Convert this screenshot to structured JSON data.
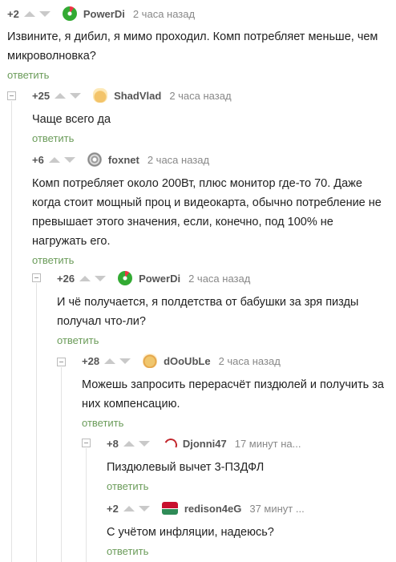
{
  "comments": [
    {
      "rating": "+2",
      "nick": "PowerDi",
      "time": "2 часа назад",
      "text": "Извините, я дибил, я мимо проходил. Комп потребляет меньше, чем микроволновка?",
      "reply": "ответить",
      "avatar": "clover-icon"
    },
    {
      "rating": "+25",
      "nick": "ShadVlad",
      "time": "2 часа назад",
      "text": "Чаще всего да",
      "reply": "ответить",
      "avatar": "face-icon"
    },
    {
      "rating": "+6",
      "nick": "foxnet",
      "time": "2 часа назад",
      "text": "Комп потребляет около 200Вт, плюс монитор где-то 70. Даже когда стоит мощный проц и видеокарта, обычно потребление не превышает этого значения, если, конечно, под 100% не нагружать его.",
      "reply": "ответить",
      "avatar": "disc-icon"
    },
    {
      "rating": "+26",
      "nick": "PowerDi",
      "time": "2 часа назад",
      "text": "И чё получается, я полдетства от бабушки за зря пизды получал что-ли?",
      "reply": "ответить",
      "avatar": "clover-icon"
    },
    {
      "rating": "+28",
      "nick": "dOoUbLe",
      "time": "2 часа назад",
      "text": "Можешь запросить перерасчёт пиздюлей и получить за них компенсацию.",
      "reply": "ответить",
      "avatar": "face-icon"
    },
    {
      "rating": "+8",
      "nick": "Djonni47",
      "time": "17 минут на...",
      "text": "Пиздюлевый вычет 3-ПЗДФЛ",
      "reply": "ответить",
      "avatar": "swirl-icon"
    },
    {
      "rating": "+2",
      "nick": "redison4eG",
      "time": "37 минут ...",
      "text": "С учётом инфляции, надеюсь?",
      "reply": "ответить",
      "avatar": "flag-icon"
    }
  ]
}
